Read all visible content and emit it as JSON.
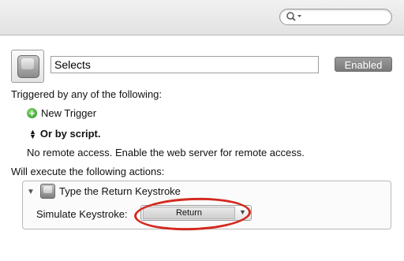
{
  "toolbar": {
    "search": {
      "placeholder": "",
      "value": "",
      "icon": "search-icon"
    }
  },
  "macro": {
    "icon": "keyboard-key-icon",
    "name": "Selects",
    "enabled_label": "Enabled"
  },
  "triggers": {
    "heading": "Triggered by any of the following:",
    "new_trigger_label": "New Trigger",
    "new_trigger_icon": "plus-circle-icon",
    "script_label": "Or by script.",
    "script_icon": "updown-arrows-icon",
    "remote_note": "No remote access.  Enable the web server for remote access."
  },
  "actions": {
    "heading": "Will execute the following actions:",
    "items": [
      {
        "title": "Type the Return Keystroke",
        "icon": "keyboard-key-icon",
        "field_label": "Simulate Keystroke:",
        "keystroke_value": "Return"
      }
    ]
  },
  "colors": {
    "highlight_ring": "#d32a1f",
    "enabled_button": "#888888",
    "plus_icon": "#3aa12e"
  }
}
